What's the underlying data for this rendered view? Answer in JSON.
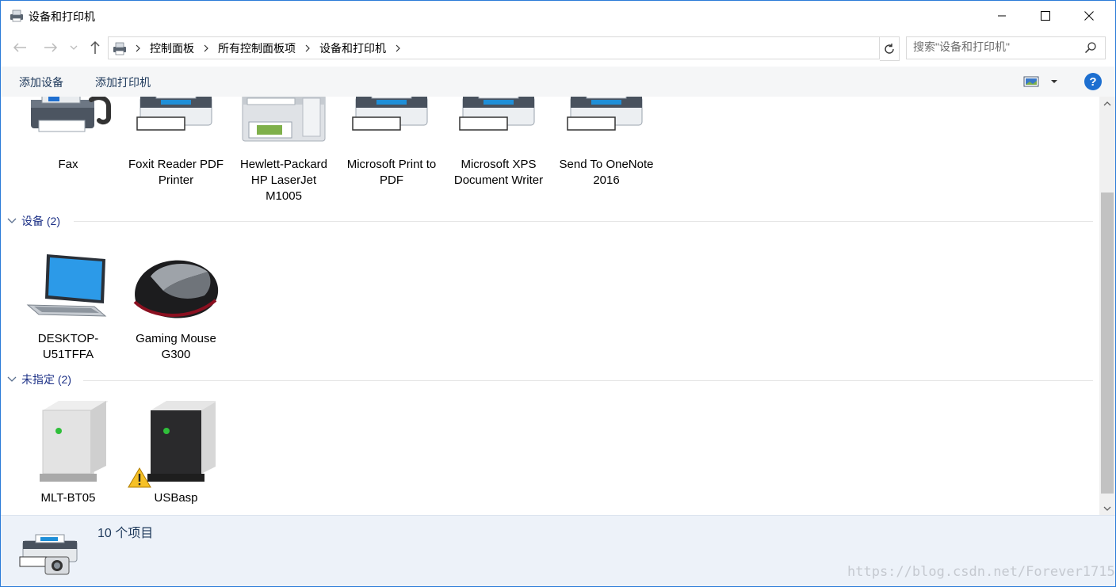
{
  "window": {
    "title": "设备和打印机",
    "controls": {
      "minimize": "minimize-icon",
      "maximize": "maximize-icon",
      "close": "close-icon"
    }
  },
  "nav": {
    "back": "back-arrow-icon",
    "forward": "forward-arrow-icon",
    "recent": "chevron-down-icon",
    "up": "up-arrow-icon"
  },
  "address": {
    "breadcrumb": [
      "控制面板",
      "所有控制面板项",
      "设备和打印机"
    ]
  },
  "search": {
    "placeholder": "搜索\"设备和打印机\""
  },
  "toolbar": {
    "add_device": "添加设备",
    "add_printer": "添加打印机",
    "help": "?"
  },
  "printers": [
    {
      "label": "Fax",
      "icon": "fax-icon"
    },
    {
      "label": "Foxit Reader PDF Printer",
      "icon": "printer-icon"
    },
    {
      "label": "Hewlett-Packard HP LaserJet M1005",
      "icon": "laserjet-printer-icon"
    },
    {
      "label": "Microsoft Print to PDF",
      "icon": "printer-icon"
    },
    {
      "label": "Microsoft XPS Document Writer",
      "icon": "printer-icon"
    },
    {
      "label": "Send To OneNote 2016",
      "icon": "printer-icon"
    }
  ],
  "groups": {
    "devices": {
      "title": "设备 (2)"
    },
    "unspecified": {
      "title": "未指定 (2)"
    }
  },
  "devices": [
    {
      "label": "DESKTOP-U51TFFA",
      "icon": "laptop-icon"
    },
    {
      "label": "Gaming Mouse G300",
      "icon": "mouse-icon"
    }
  ],
  "unspecified": [
    {
      "label": "MLT-BT05",
      "icon": "generic-device-icon"
    },
    {
      "label": "USBasp",
      "icon": "generic-device-icon",
      "warning": "warning-icon"
    }
  ],
  "details": {
    "count": "10 个项目"
  },
  "watermark": "https://blog.csdn.net/Forever1715",
  "colors": {
    "accent": "#1d6fd0",
    "group_text": "#1e3287",
    "command_text": "#1e395b",
    "details_bg": "#edf2f9",
    "window_border": "#2b7bd8"
  }
}
